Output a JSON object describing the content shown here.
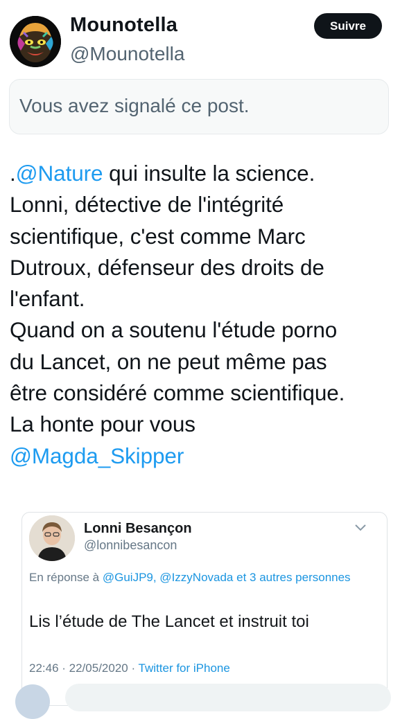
{
  "author": {
    "display_name": "Mounotella",
    "handle": "@Mounotella",
    "avatar_icon": "painted-monkey-avatar"
  },
  "follow_button": {
    "label": "Suivre"
  },
  "report_notice": {
    "text": "Vous avez signalé ce post."
  },
  "tweet": {
    "lines": [
      {
        "prefix": ".",
        "mention": "@Nature",
        "suffix": " qui insulte la science."
      },
      {
        "text": "Lonni, détective de l'intégrité"
      },
      {
        "text": "scientifique, c'est comme Marc"
      },
      {
        "text": "Dutroux, défenseur des droits de"
      },
      {
        "text": "l'enfant."
      },
      {
        "text": "Quand on a soutenu l'étude porno"
      },
      {
        "text": "du Lancet, on ne peut même pas"
      },
      {
        "text": "être considéré comme scientifique."
      },
      {
        "text": "La honte pour vous"
      },
      {
        "mention": "@Magda_Skipper"
      }
    ]
  },
  "quoted": {
    "display_name": "Lonni Besançon",
    "handle": "@lonnibesancon",
    "reply_prefix": "En réponse à ",
    "reply_mentions": "@GuiJP9, @IzzyNovada",
    "reply_suffix": " et 3 autres personnes",
    "body": "Lis l’étude de The Lancet et instruit toi",
    "timestamp": "22:46 · 22/05/2020 · ",
    "source": "Twitter for iPhone",
    "menu_icon": "chevron-down-icon"
  },
  "colors": {
    "accent": "#1d9bf0",
    "text": "#0f1419",
    "muted": "#536471",
    "button_bg": "#0f1419"
  }
}
